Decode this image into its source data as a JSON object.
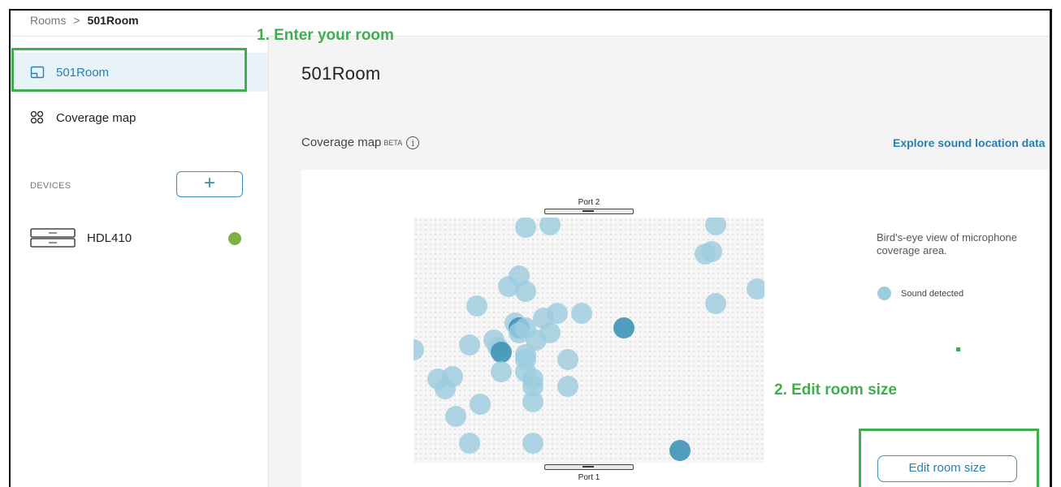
{
  "breadcrumb": {
    "root": "Rooms",
    "separator": ">",
    "current": "501Room"
  },
  "sidebar": {
    "items": [
      {
        "label": "501Room",
        "icon": "room-icon",
        "active": true
      },
      {
        "label": "Coverage map",
        "icon": "grid-icon",
        "active": false
      }
    ],
    "devices_label": "DEVICES",
    "add_label": "+",
    "devices": [
      {
        "name": "HDL410",
        "icon": "device-icon",
        "status_color": "#7cb342"
      }
    ]
  },
  "main": {
    "title": "501Room",
    "section_title": "Coverage map",
    "section_badge": "BETA",
    "info_glyph": "i",
    "explore_link": "Explore sound location data",
    "port_top": "Port 2",
    "port_bottom": "Port 1",
    "description": "Bird's-eye view of microphone coverage area.",
    "legend_label": "Sound detected",
    "edit_button": "Edit room size",
    "bubble_colors": {
      "light": "#9ccce0",
      "dark": "#3f93b8"
    },
    "sound_points": [
      [
        0.32,
        0.04,
        "l"
      ],
      [
        0.39,
        0.03,
        "l"
      ],
      [
        0.86,
        0.03,
        "l"
      ],
      [
        0.85,
        0.14,
        "l"
      ],
      [
        0.83,
        0.15,
        "l"
      ],
      [
        0.3,
        0.24,
        "l"
      ],
      [
        0.27,
        0.28,
        "l"
      ],
      [
        0.32,
        0.3,
        "l"
      ],
      [
        0.98,
        0.29,
        "l"
      ],
      [
        0.86,
        0.35,
        "l"
      ],
      [
        0.18,
        0.36,
        "l"
      ],
      [
        0.29,
        0.43,
        "l"
      ],
      [
        0.3,
        0.45,
        "d"
      ],
      [
        0.32,
        0.45,
        "l"
      ],
      [
        0.3,
        0.47,
        "l"
      ],
      [
        0.37,
        0.41,
        "l"
      ],
      [
        0.41,
        0.39,
        "l"
      ],
      [
        0.48,
        0.39,
        "l"
      ],
      [
        0.39,
        0.47,
        "l"
      ],
      [
        0.6,
        0.45,
        "d"
      ],
      [
        0.35,
        0.5,
        "l"
      ],
      [
        0.23,
        0.5,
        "l"
      ],
      [
        0.24,
        0.53,
        "l"
      ],
      [
        0.25,
        0.55,
        "d"
      ],
      [
        0.16,
        0.52,
        "l"
      ],
      [
        0.32,
        0.56,
        "l"
      ],
      [
        0.32,
        0.58,
        "l"
      ],
      [
        0.0,
        0.54,
        "l"
      ],
      [
        0.44,
        0.58,
        "l"
      ],
      [
        0.25,
        0.63,
        "l"
      ],
      [
        0.32,
        0.63,
        "l"
      ],
      [
        0.07,
        0.66,
        "l"
      ],
      [
        0.11,
        0.65,
        "l"
      ],
      [
        0.09,
        0.7,
        "l"
      ],
      [
        0.34,
        0.66,
        "l"
      ],
      [
        0.34,
        0.69,
        "l"
      ],
      [
        0.44,
        0.69,
        "l"
      ],
      [
        0.34,
        0.75,
        "l"
      ],
      [
        0.19,
        0.76,
        "l"
      ],
      [
        0.12,
        0.81,
        "l"
      ],
      [
        0.16,
        0.92,
        "l"
      ],
      [
        0.34,
        0.92,
        "l"
      ],
      [
        0.76,
        0.95,
        "d"
      ]
    ]
  },
  "annotations": {
    "step1": "1. Enter your room",
    "step2": "2. Edit room size",
    "color": "#3fae4f"
  }
}
